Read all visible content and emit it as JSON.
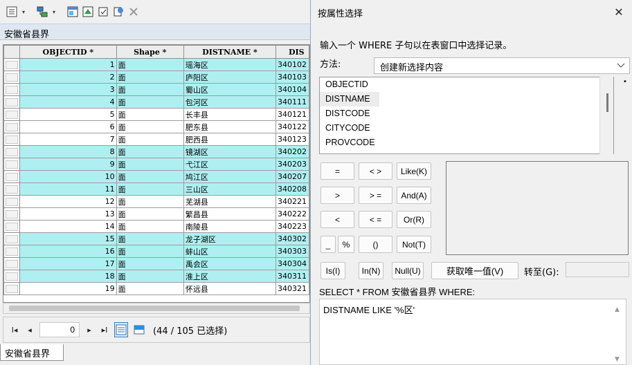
{
  "table_window": {
    "title": "安徽省县界",
    "tab_label": "安徽省县界",
    "columns": [
      {
        "label": "OBJECTID *",
        "width": 142
      },
      {
        "label": "Shape *",
        "width": 99
      },
      {
        "label": "DISTNAME *",
        "width": 135
      },
      {
        "label": "DIS",
        "width": 48
      }
    ],
    "rows": [
      {
        "objectid": "1",
        "shape": "面",
        "distname": "瑶海区",
        "distcode": "340102",
        "selected": true
      },
      {
        "objectid": "2",
        "shape": "面",
        "distname": "庐阳区",
        "distcode": "340103",
        "selected": true
      },
      {
        "objectid": "3",
        "shape": "面",
        "distname": "蜀山区",
        "distcode": "340104",
        "selected": true
      },
      {
        "objectid": "4",
        "shape": "面",
        "distname": "包河区",
        "distcode": "340111",
        "selected": true
      },
      {
        "objectid": "5",
        "shape": "面",
        "distname": "长丰县",
        "distcode": "340121",
        "selected": false
      },
      {
        "objectid": "6",
        "shape": "面",
        "distname": "肥东县",
        "distcode": "340122",
        "selected": false
      },
      {
        "objectid": "7",
        "shape": "面",
        "distname": "肥西县",
        "distcode": "340123",
        "selected": false
      },
      {
        "objectid": "8",
        "shape": "面",
        "distname": "镜湖区",
        "distcode": "340202",
        "selected": true
      },
      {
        "objectid": "9",
        "shape": "面",
        "distname": "弋江区",
        "distcode": "340203",
        "selected": true
      },
      {
        "objectid": "10",
        "shape": "面",
        "distname": "鸠江区",
        "distcode": "340207",
        "selected": true
      },
      {
        "objectid": "11",
        "shape": "面",
        "distname": "三山区",
        "distcode": "340208",
        "selected": true
      },
      {
        "objectid": "12",
        "shape": "面",
        "distname": "芜湖县",
        "distcode": "340221",
        "selected": false
      },
      {
        "objectid": "13",
        "shape": "面",
        "distname": "繁昌县",
        "distcode": "340222",
        "selected": false
      },
      {
        "objectid": "14",
        "shape": "面",
        "distname": "南陵县",
        "distcode": "340223",
        "selected": false
      },
      {
        "objectid": "15",
        "shape": "面",
        "distname": "龙子湖区",
        "distcode": "340302",
        "selected": true
      },
      {
        "objectid": "16",
        "shape": "面",
        "distname": "蚌山区",
        "distcode": "340303",
        "selected": true
      },
      {
        "objectid": "17",
        "shape": "面",
        "distname": "禹会区",
        "distcode": "340304",
        "selected": true
      },
      {
        "objectid": "18",
        "shape": "面",
        "distname": "淮上区",
        "distcode": "340311",
        "selected": true
      },
      {
        "objectid": "19",
        "shape": "面",
        "distname": "怀远县",
        "distcode": "340321",
        "selected": false
      }
    ],
    "navigator": {
      "record": "0",
      "selection_status": "(44 / 105 已选择)"
    }
  },
  "dialog": {
    "title": "按属性选择",
    "description": "输入一个 WHERE 子句以在表窗口中选择记录。",
    "method_label": "方法:",
    "method_value": "创建新选择内容",
    "fields": [
      "OBJECTID",
      "DISTNAME",
      "DISTCODE",
      "CITYCODE",
      "PROVCODE"
    ],
    "selected_field": "DISTNAME",
    "operators": {
      "eq": "=",
      "ne": "< >",
      "like": "Like(K)",
      "gt": ">",
      "ge": "> =",
      "and": "And(A)",
      "lt": "<",
      "le": "< =",
      "or": "Or(R)",
      "underscore": "_",
      "percent": "%",
      "parens": "()",
      "not": "Not(T)",
      "is": "Is(I)",
      "in": "In(N)",
      "null": "Null(U)"
    },
    "get_unique_label": "获取唯一值(V)",
    "goto_label": "转至(G):",
    "query_label": "SELECT * FROM 安徽省县界 WHERE:",
    "query_text": "DISTNAME LIKE '%区'",
    "colors": {
      "selected_row": "#aef0f2"
    }
  }
}
